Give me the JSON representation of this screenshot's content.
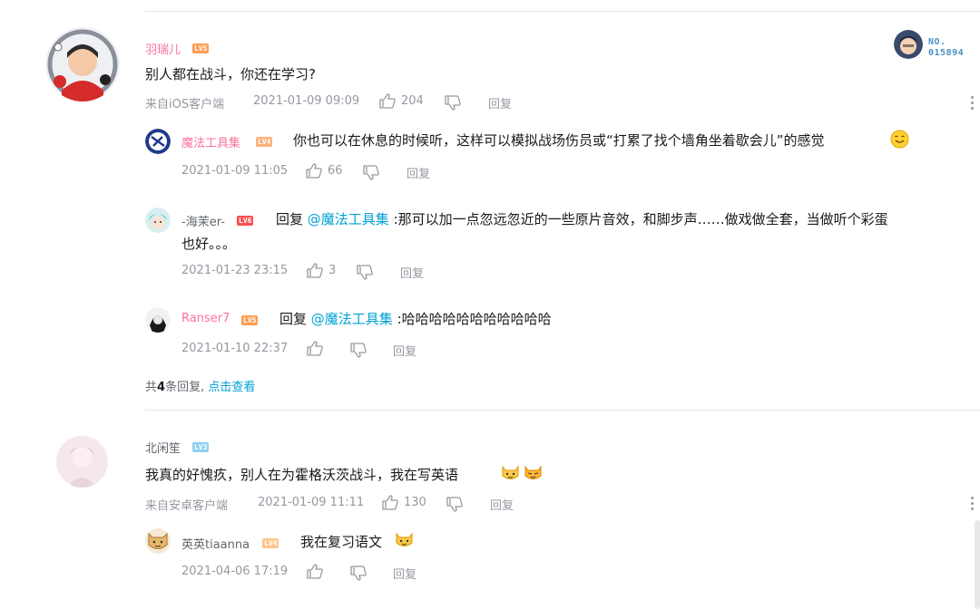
{
  "comments": [
    {
      "user": "羽瑞儿",
      "level": "LV5",
      "level_color": "#ff9d52",
      "text": "别人都在战斗，你还在学习?",
      "source": "来自iOS客户端",
      "time": "2021-01-09 09:09",
      "likes": "204",
      "reply_label": "回复",
      "badge_no": "NO.",
      "badge_num": "015894",
      "replies": [
        {
          "user": "魔法工具集",
          "level": "LV4",
          "level_color": "#ffb07a",
          "text": "你也可以在休息的时候听，这样可以模拟战场伤员或“打累了找个墙角坐着歇会儿”的感觉",
          "time": "2021-01-09 11:05",
          "likes": "66",
          "reply_label": "回复"
        },
        {
          "user": "-海茉er-",
          "level": "LV6",
          "level_color": "#ff4d4d",
          "prefix": "回复 ",
          "at": "@魔法工具集",
          "text": " :那可以加一点忽远忽近的一些原片音效，和脚步声……做戏做全套，当做听个彩蛋",
          "text2": "也好。。。",
          "time": "2021-01-23 23:15",
          "likes": "3",
          "reply_label": "回复"
        },
        {
          "user": "Ranser7",
          "level": "LV5",
          "level_color": "#ff9d52",
          "prefix": "回复 ",
          "at": "@魔法工具集",
          "text": " :哈哈哈哈哈哈哈哈哈哈哈",
          "time": "2021-01-10 22:37",
          "likes": "",
          "reply_label": "回复"
        }
      ],
      "more": {
        "pre": "共",
        "count": "4",
        "post": "条回复, ",
        "link": "点击查看"
      }
    },
    {
      "user": "北闲笙",
      "level": "LV3",
      "level_color": "#8bd1f0",
      "text": "我真的好愧疚，别人在为霍格沃茨战斗，我在写英语",
      "source": "来自安卓客户端",
      "time": "2021-01-09 11:11",
      "likes": "130",
      "reply_label": "回复",
      "replies": [
        {
          "user": "英英tiaanna",
          "level": "LV4",
          "level_color": "#ffc48a",
          "text": "我在复习语文",
          "time": "2021-04-06 17:19",
          "likes": "",
          "reply_label": "回复"
        }
      ]
    }
  ]
}
